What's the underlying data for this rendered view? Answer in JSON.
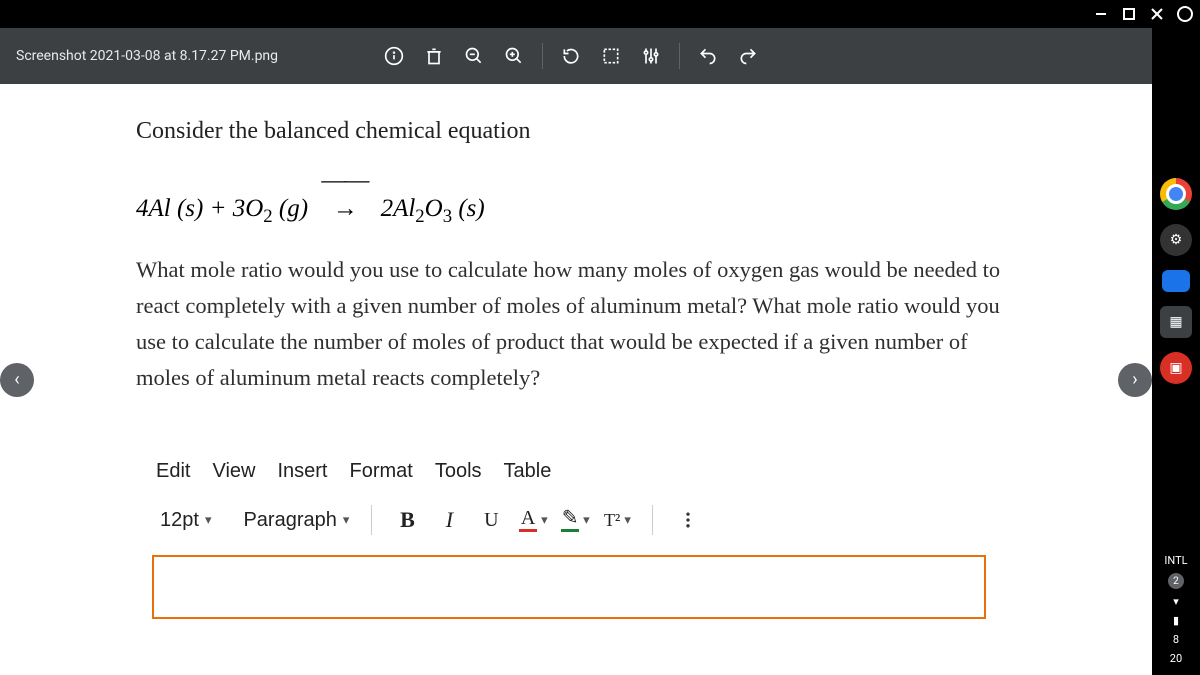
{
  "window": {
    "filename": "Screenshot 2021-03-08 at 8.17.27 PM.png"
  },
  "question": {
    "title": "Consider the balanced chemical equation",
    "equation": {
      "lhs_a": "4Al (s)",
      "plus": " + ",
      "lhs_b_pre": "3O",
      "lhs_b_sub": "2",
      "lhs_b_post": " (g)",
      "arrow": "——→",
      "rhs_pre": " 2Al",
      "rhs_sub1": "2",
      "rhs_mid": "O",
      "rhs_sub2": "3",
      "rhs_post": " (s)"
    },
    "body": "What mole ratio would you use to calculate how many moles of oxygen gas would be needed to react completely with a given number of moles of aluminum metal? What mole ratio would you use to calculate the number of moles of product that would be expected if a given number of moles of aluminum metal reacts completely?"
  },
  "editor": {
    "menus": [
      "Edit",
      "View",
      "Insert",
      "Format",
      "Tools",
      "Table"
    ],
    "font_size": "12pt",
    "style": "Paragraph",
    "t2_label": "T²"
  },
  "dock": {
    "intl": "INTL",
    "badge": "2",
    "time1": "8",
    "time2": "20"
  }
}
